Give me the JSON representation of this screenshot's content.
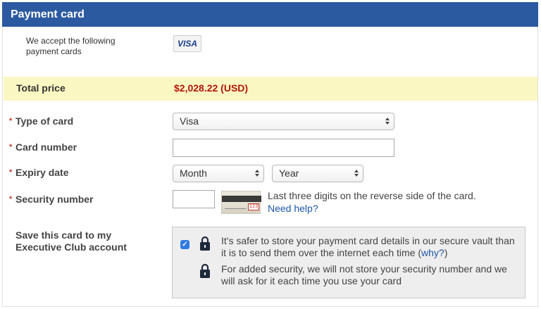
{
  "header": {
    "title": "Payment card"
  },
  "accepted": {
    "label": "We accept the following payment cards",
    "cards": [
      "VISA"
    ]
  },
  "total": {
    "label": "Total price",
    "value": "$2,028.22 (USD)"
  },
  "form": {
    "required_marker": "*",
    "card_type": {
      "label": "Type of card",
      "value": "Visa"
    },
    "card_number": {
      "label": "Card number",
      "value": ""
    },
    "expiry": {
      "label": "Expiry date",
      "month_value": "Month",
      "year_value": "Year"
    },
    "security": {
      "label": "Security number",
      "value": "",
      "card_hint_digits": "123",
      "help_text": "Last three digits on the reverse side of the card.",
      "help_link": "Need help?"
    },
    "save": {
      "label": "Save this card to my Executive Club account",
      "checked": true,
      "message_1_pre": "It's safer to store your payment card details in our secure vault than it is to send them over the internet each time (",
      "message_1_link": "why?",
      "message_1_post": ")",
      "message_2": "For added security, we will not store your security number and we will ask for it each time you use your card"
    }
  },
  "colors": {
    "header_bg": "#2b5aa1",
    "total_bg": "#fbf7c2",
    "total_value": "#b3150e",
    "link": "#1f56a8",
    "required": "#c0392b"
  }
}
